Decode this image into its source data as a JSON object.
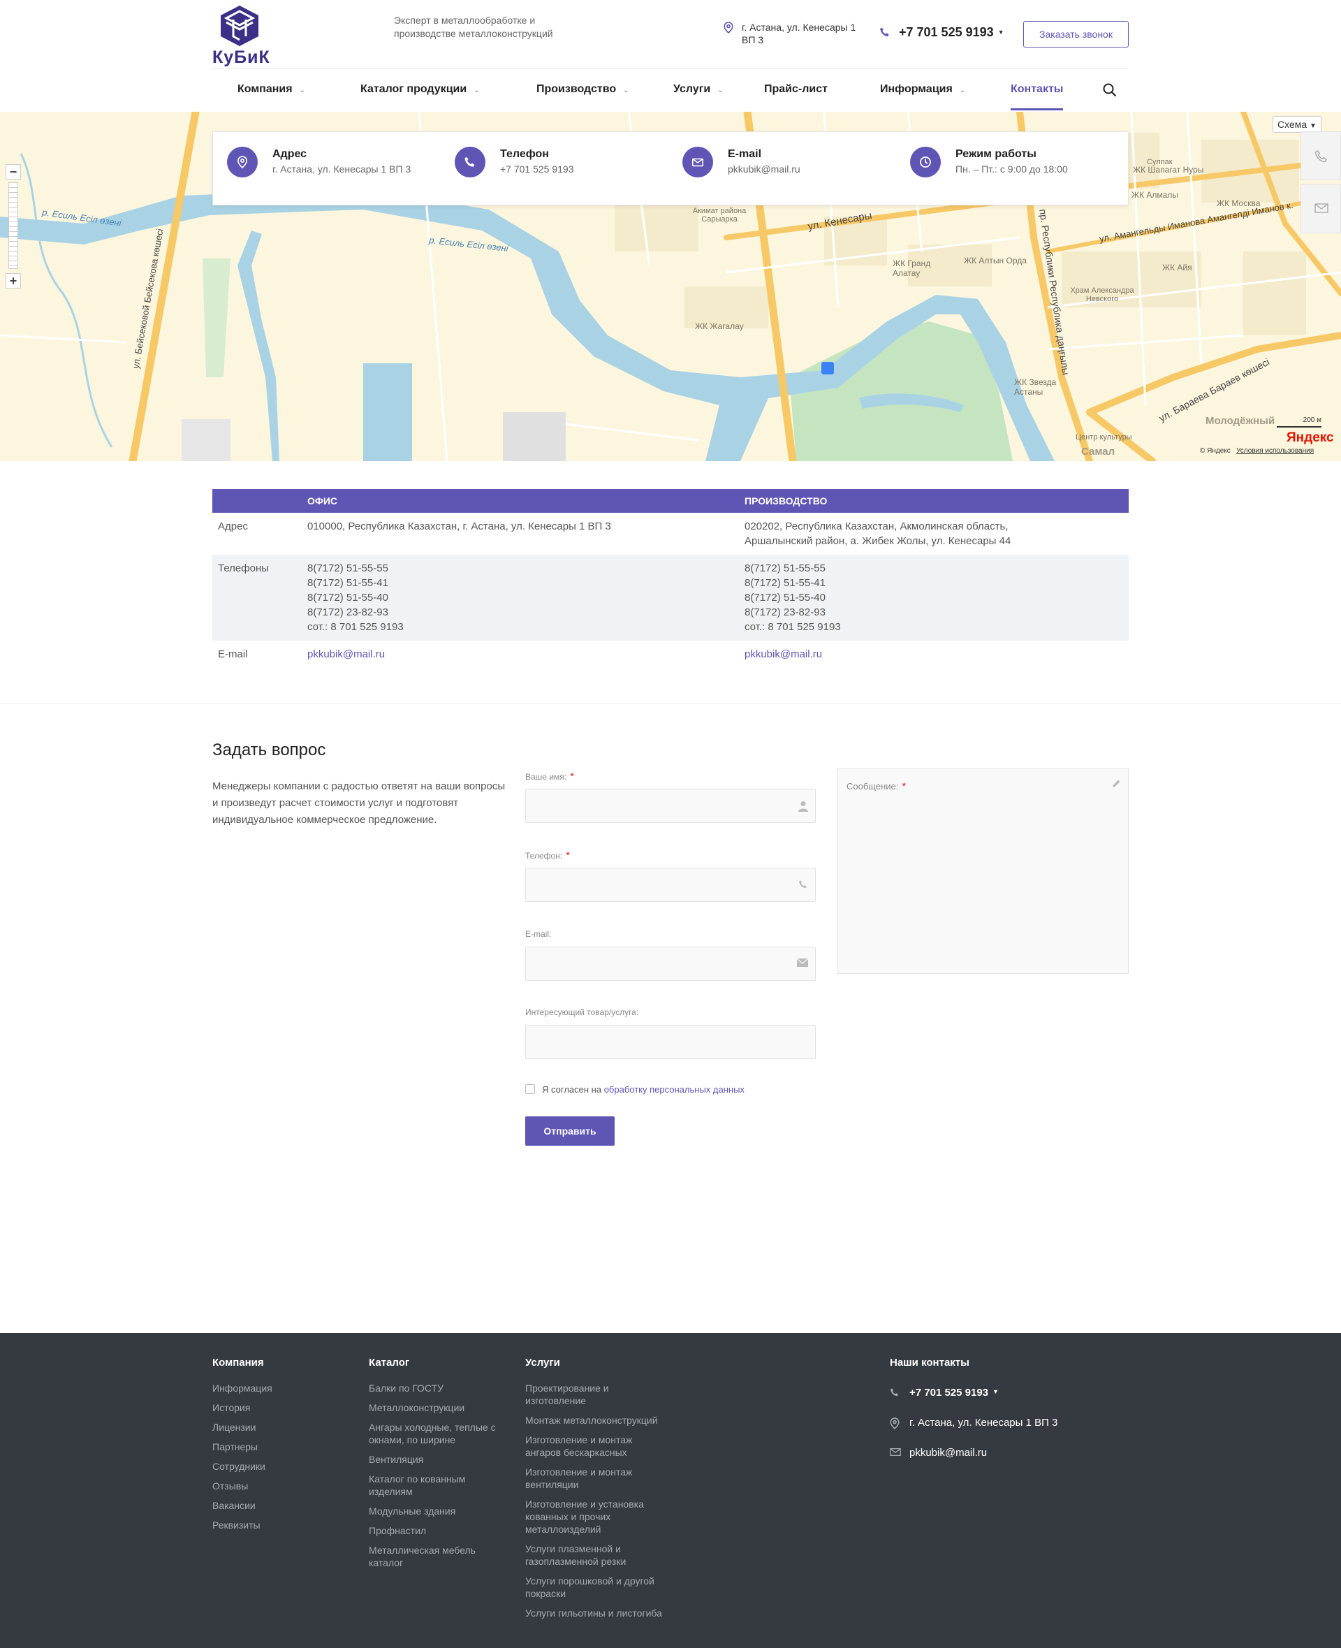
{
  "header": {
    "logo_text": "КуБиК",
    "tagline": "Эксперт в металлообработке и производстве металлоконструкций",
    "address": "г. Астана, ул. Кенесары 1 ВП 3",
    "phone": "+7 701 525 9193",
    "callback_button": "Заказать звонок"
  },
  "nav": [
    {
      "label": "Компания",
      "dropdown": true
    },
    {
      "label": "Каталог продукции",
      "dropdown": true
    },
    {
      "label": "Производство",
      "dropdown": true
    },
    {
      "label": "Услуги",
      "dropdown": true
    },
    {
      "label": "Прайс-лист",
      "dropdown": false
    },
    {
      "label": "Информация",
      "dropdown": true
    },
    {
      "label": "Контакты",
      "dropdown": false,
      "active": true
    }
  ],
  "map": {
    "type_selector": "Схема",
    "labels": {
      "river1": "р. Есиль Есіл өзені",
      "river2": "р. Есиль Есіл өзені",
      "street_kenesary": "ул. Кенесары",
      "street_beisekova": "ул. Бейсековой Бейсекова көшесі",
      "street_respubliki": "пр. Республики Республика даңғылы",
      "street_amangeldy": "ул. Амангельды Иманова Амангелді Иманов к.",
      "street_baraeva": "ул. Бараева Бараев көшесі",
      "district1": "ЖК Жагалау",
      "district2": "ЖК Гранд Алатау",
      "district3": "ЖК Алтын Орда",
      "district4": "ЖК Алмалы",
      "district5": "ЖК Москва",
      "district6": "ЖК Айя",
      "district7": "ЖК Шапагат Нуры",
      "district8": "ЖК Звезда Астаны",
      "district9": "Молодёжный",
      "district10": "Самал",
      "poi1": "Храм Александра Невского",
      "poi2": "Центр культуры",
      "poi3": "Акимат района Сарыарка",
      "poi4": "Сулпак"
    },
    "scale": "200 м",
    "brand": "Яндекс",
    "copyright": "© Яндекс",
    "terms": "Условия использования"
  },
  "info_card": [
    {
      "title": "Адрес",
      "value": "г. Астана, ул. Кенесары 1 ВП 3",
      "icon": "location-pin-icon"
    },
    {
      "title": "Телефон",
      "value": "+7 701 525 9193",
      "icon": "phone-icon"
    },
    {
      "title": "E-mail",
      "value": "pkkubik@mail.ru",
      "icon": "email-icon"
    },
    {
      "title": "Режим работы",
      "value": "Пн. – Пт.: с 9:00 до 18:00",
      "icon": "clock-icon"
    }
  ],
  "contacts_table": {
    "headers": [
      "",
      "Офис",
      "Производство"
    ],
    "rows": [
      {
        "label": "Адрес",
        "office": [
          "010000, Республика Казахстан, г. Астана, ул. Кенесары 1 ВП 3"
        ],
        "production": [
          "020202, Республика Казахстан, Акмолинская область,",
          "Аршалынский район, а. Жибек Жолы, ул. Кенесары 44"
        ]
      },
      {
        "label": "Телефоны",
        "office": [
          "8(7172) 51-55-55",
          "8(7172) 51-55-41",
          "8(7172) 51-55-40",
          "8(7172) 23-82-93",
          "сот.: 8 701 525 9193"
        ],
        "production": [
          "8(7172) 51-55-55",
          "8(7172) 51-55-41",
          "8(7172) 51-55-40",
          "8(7172) 23-82-93",
          "сот.: 8 701 525 9193"
        ]
      },
      {
        "label": "E-mail",
        "office_email": "pkkubik@mail.ru",
        "production_email": "pkkubik@mail.ru"
      }
    ]
  },
  "form": {
    "title": "Задать вопрос",
    "description": "Менеджеры компании с радостью ответят на ваши вопросы и произведут расчет стоимости услуг и подготовят индивидуальное коммерческое предложение.",
    "name_label": "Ваше имя:",
    "phone_label": "Телефон:",
    "email_label": "E-mail:",
    "product_label": "Интересующий товар/услуга:",
    "message_label": "Сообщение:",
    "required_mark": "*",
    "agree_text": "Я согласен на",
    "agree_link": "обработку персональных данных",
    "submit": "Отправить"
  },
  "footer": {
    "company": {
      "title": "Компания",
      "links": [
        "Информация",
        "История",
        "Лицензии",
        "Партнеры",
        "Сотрудники",
        "Отзывы",
        "Вакансии",
        "Реквизиты"
      ]
    },
    "catalog": {
      "title": "Каталог",
      "links": [
        "Балки по ГОСТУ",
        "Металлоконструкции",
        "Ангары холодные, теплые с окнами, по ширине",
        "Вентиляция",
        "Каталог по кованным изделиям",
        "Модульные здания",
        "Профнастил",
        "Металлическая мебель каталог"
      ]
    },
    "services": {
      "title": "Услуги",
      "links": [
        "Проектирование и изготовление",
        "Монтаж металлоконструкций",
        "Изготовление и монтаж ангаров бескаркасных",
        "Изготовление и монтаж вентиляции",
        "Изготовление и установка кованных и прочих металлоизделий",
        "Услуги плазменной и газоплазменной резки",
        "Услуги порошковой и другой покраски",
        "Услуги гильотины и листогиба"
      ]
    },
    "contacts": {
      "title": "Наши контакты",
      "phone": "+7 701 525 9193",
      "address": "г. Астана, ул. Кенесары 1 ВП 3",
      "email": "pkkubik@mail.ru"
    }
  },
  "colors": {
    "accent": "#5e55b5",
    "logo": "#3b2f87",
    "footer_bg": "#353940",
    "water": "#a9d3e5",
    "land": "#fdf6de",
    "park": "#c5e4c0"
  }
}
